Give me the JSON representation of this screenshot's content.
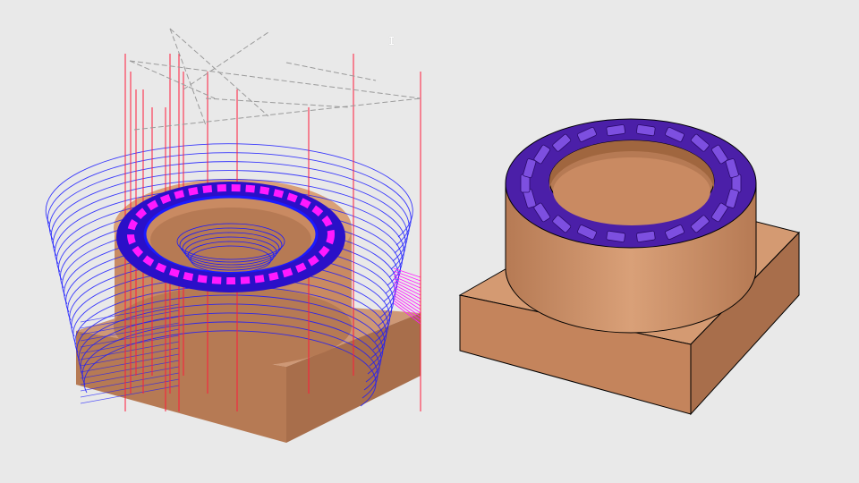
{
  "viewport": {
    "background": "#e9e9e9"
  },
  "colors": {
    "stock": "#c98a62",
    "stock_light": "#d9a078",
    "stock_dark": "#a86e4b",
    "part_purple": "#4b1fa8",
    "part_purple_light": "#7d4fe0",
    "toolpath_blue": "#1a1aff",
    "toolpath_magenta": "#ff1aff",
    "link_red": "#ff1a3a",
    "rapid_gray": "#9a9a9a",
    "edge": "#000000"
  },
  "views": [
    {
      "name": "toolpath-view"
    },
    {
      "name": "finished-part-view"
    }
  ],
  "cursor": {
    "icon": "text-cursor-icon",
    "glyph": "I"
  }
}
